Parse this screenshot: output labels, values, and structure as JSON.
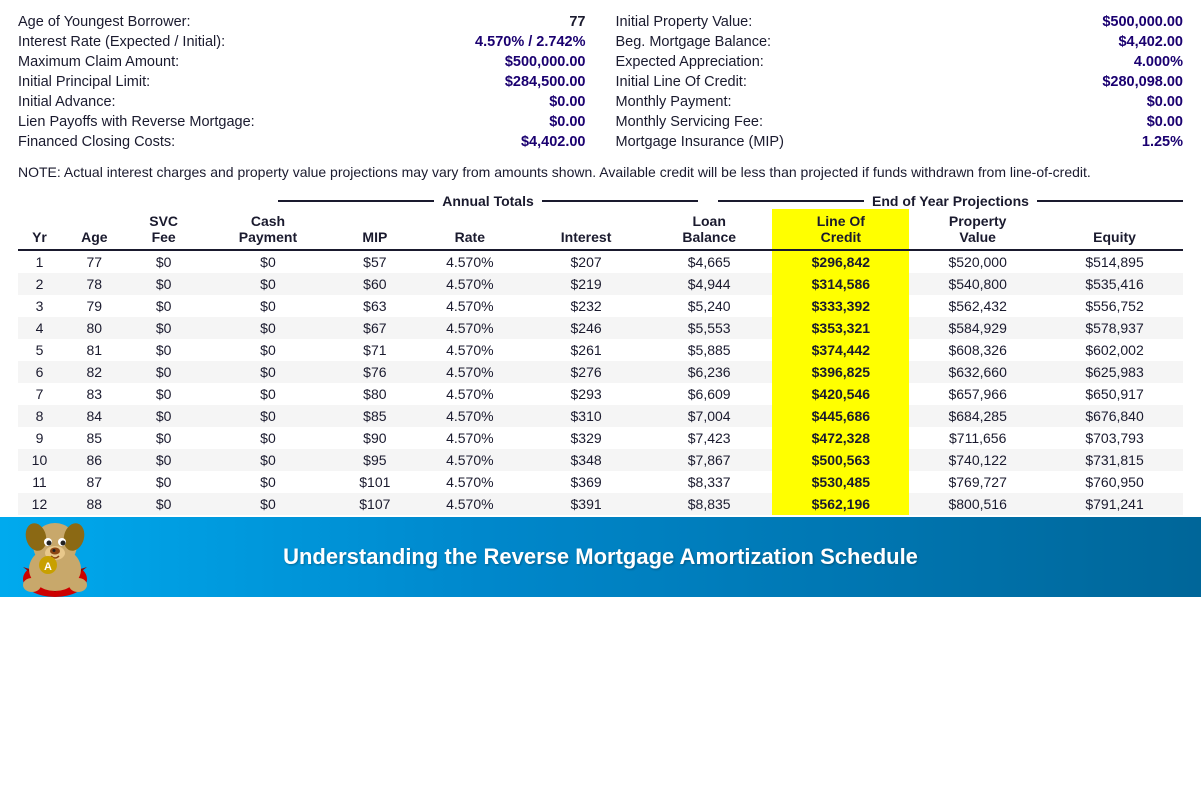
{
  "header": {
    "left": [
      {
        "label": "Age of Youngest Borrower:",
        "value": "77",
        "bold": false
      },
      {
        "label": "Interest Rate (Expected / Initial):",
        "value": "4.570%  /  2.742%",
        "bold": true
      },
      {
        "label": "Maximum Claim Amount:",
        "value": "$500,000.00",
        "bold": true
      },
      {
        "label": "Initial Principal Limit:",
        "value": "$284,500.00",
        "bold": true
      },
      {
        "label": "Initial Advance:",
        "value": "$0.00",
        "bold": true
      },
      {
        "label": "Lien Payoffs with Reverse Mortgage:",
        "value": "$0.00",
        "bold": true
      },
      {
        "label": "Financed Closing Costs:",
        "value": "$4,402.00",
        "bold": true
      }
    ],
    "right": [
      {
        "label": "Initial Property Value:",
        "value": "$500,000.00",
        "bold": true
      },
      {
        "label": "Beg. Mortgage Balance:",
        "value": "$4,402.00",
        "bold": true
      },
      {
        "label": "Expected Appreciation:",
        "value": "4.000%",
        "bold": true
      },
      {
        "label": "Initial Line Of Credit:",
        "value": "$280,098.00",
        "bold": true
      },
      {
        "label": "Monthly Payment:",
        "value": "$0.00",
        "bold": true
      },
      {
        "label": "Monthly Servicing Fee:",
        "value": "$0.00",
        "bold": true
      },
      {
        "label": "Mortgage Insurance (MIP)",
        "value": "1.25%",
        "bold": false
      }
    ]
  },
  "note": "NOTE:  Actual interest charges and property value projections may vary from amounts shown.  Available credit will be less than projected if funds withdrawn from line-of-credit.",
  "annual_totals_label": "Annual Totals",
  "eoy_label": "End of Year Projections",
  "columns": [
    "Yr",
    "Age",
    "SVC\nFee",
    "Cash\nPayment",
    "MIP",
    "Rate",
    "Interest",
    "Loan\nBalance",
    "Line Of\nCredit",
    "Property\nValue",
    "Equity"
  ],
  "rows": [
    [
      1,
      77,
      "$0",
      "$0",
      "$57",
      "4.570%",
      "$207",
      "$4,665",
      "$296,842",
      "$520,000",
      "$514,895"
    ],
    [
      2,
      78,
      "$0",
      "$0",
      "$60",
      "4.570%",
      "$219",
      "$4,944",
      "$314,586",
      "$540,800",
      "$535,416"
    ],
    [
      3,
      79,
      "$0",
      "$0",
      "$63",
      "4.570%",
      "$232",
      "$5,240",
      "$333,392",
      "$562,432",
      "$556,752"
    ],
    [
      4,
      80,
      "$0",
      "$0",
      "$67",
      "4.570%",
      "$246",
      "$5,553",
      "$353,321",
      "$584,929",
      "$578,937"
    ],
    [
      5,
      81,
      "$0",
      "$0",
      "$71",
      "4.570%",
      "$261",
      "$5,885",
      "$374,442",
      "$608,326",
      "$602,002"
    ],
    [
      6,
      82,
      "$0",
      "$0",
      "$76",
      "4.570%",
      "$276",
      "$6,236",
      "$396,825",
      "$632,660",
      "$625,983"
    ],
    [
      7,
      83,
      "$0",
      "$0",
      "$80",
      "4.570%",
      "$293",
      "$6,609",
      "$420,546",
      "$657,966",
      "$650,917"
    ],
    [
      8,
      84,
      "$0",
      "$0",
      "$85",
      "4.570%",
      "$310",
      "$7,004",
      "$445,686",
      "$684,285",
      "$676,840"
    ],
    [
      9,
      85,
      "$0",
      "$0",
      "$90",
      "4.570%",
      "$329",
      "$7,423",
      "$472,328",
      "$711,656",
      "$703,793"
    ],
    [
      10,
      86,
      "$0",
      "$0",
      "$95",
      "4.570%",
      "$348",
      "$7,867",
      "$500,563",
      "$740,122",
      "$731,815"
    ],
    [
      11,
      87,
      "$0",
      "$0",
      "$101",
      "4.570%",
      "$369",
      "$8,337",
      "$530,485",
      "$769,727",
      "$760,950"
    ],
    [
      12,
      88,
      "$0",
      "$0",
      "$107",
      "4.570%",
      "$391",
      "$8,835",
      "$562,196",
      "$800,516",
      "$791,241"
    ]
  ],
  "footer": {
    "text": "Understanding the Reverse Mortgage Amortization Schedule"
  }
}
